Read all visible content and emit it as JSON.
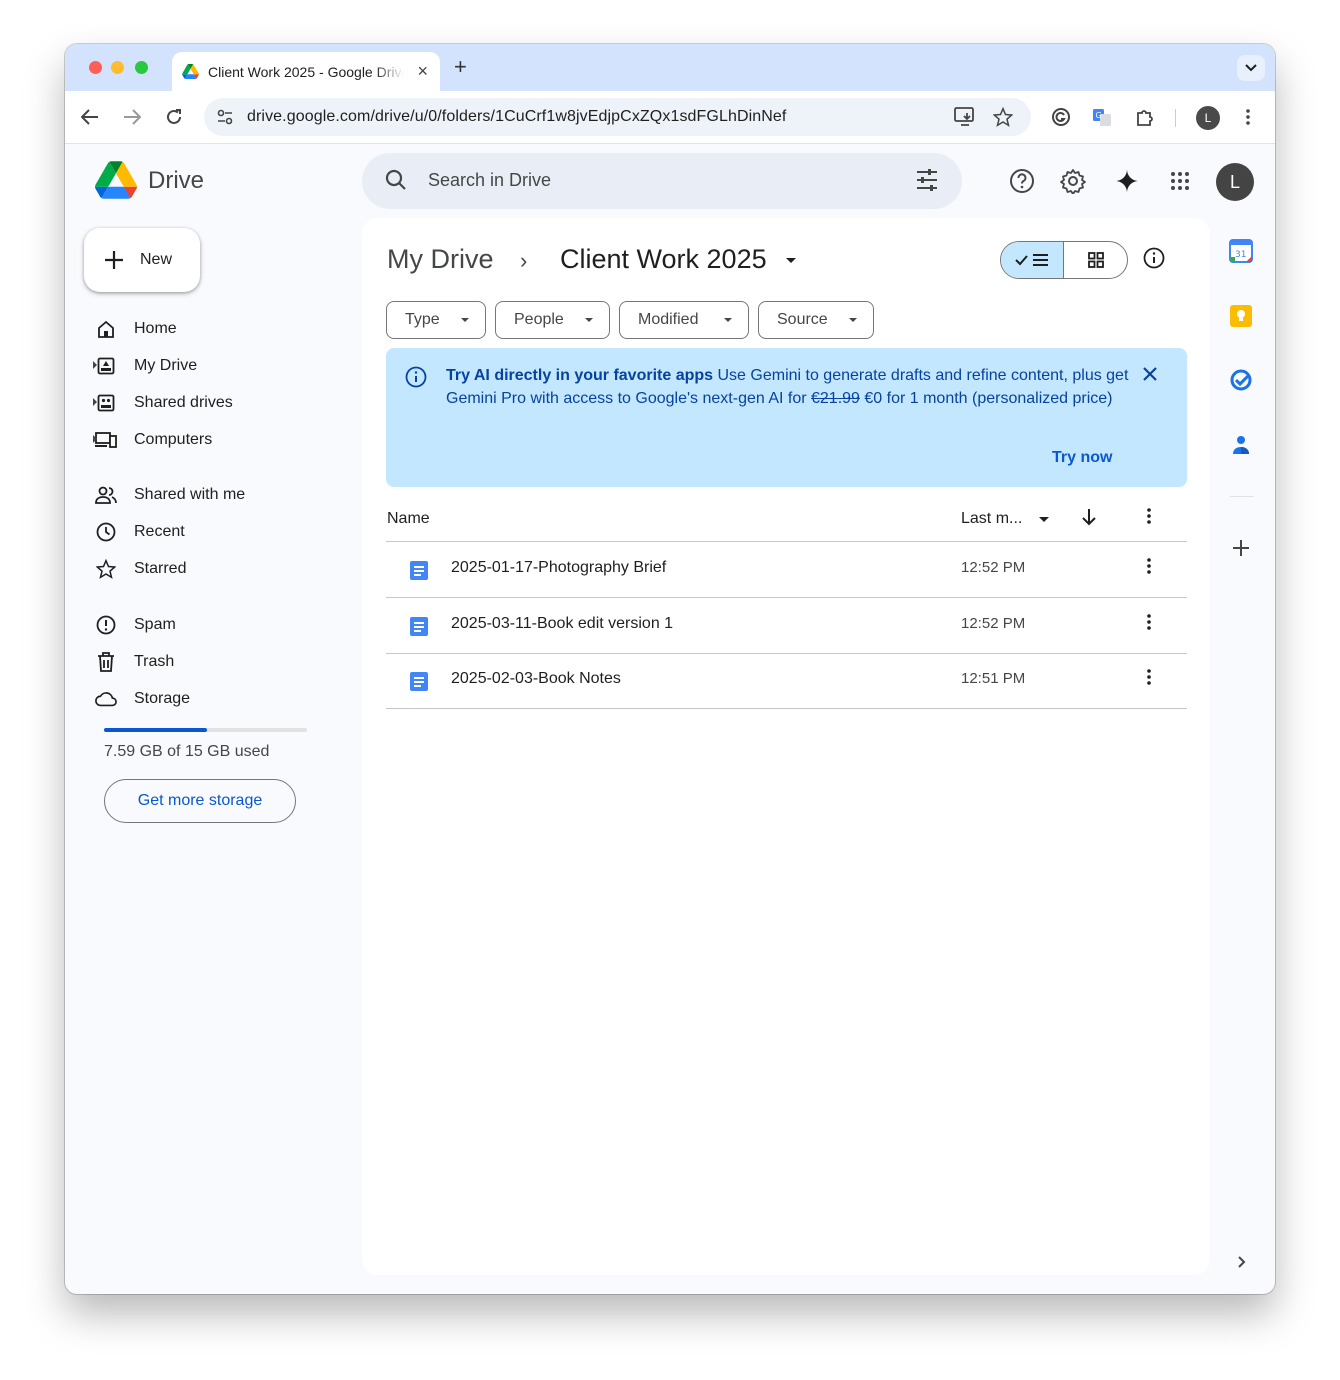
{
  "browser": {
    "tab_title": "Client Work 2025 - Google Drive",
    "url": "drive.google.com/drive/u/0/folders/1CuCrf1w8jvEdjpCxZQx1sdFGLhDinNef",
    "profile_initial": "L"
  },
  "header": {
    "app_name": "Drive",
    "search_placeholder": "Search in Drive",
    "profile_initial": "L"
  },
  "sidebar": {
    "new_label": "New",
    "items": [
      {
        "label": "Home",
        "icon": "home-icon"
      },
      {
        "label": "My Drive",
        "icon": "my-drive-icon"
      },
      {
        "label": "Shared drives",
        "icon": "shared-drives-icon"
      },
      {
        "label": "Computers",
        "icon": "computers-icon"
      },
      {
        "label": "Shared with me",
        "icon": "people-icon"
      },
      {
        "label": "Recent",
        "icon": "clock-icon"
      },
      {
        "label": "Starred",
        "icon": "star-icon"
      },
      {
        "label": "Spam",
        "icon": "spam-icon"
      },
      {
        "label": "Trash",
        "icon": "trash-icon"
      },
      {
        "label": "Storage",
        "icon": "cloud-icon"
      }
    ],
    "storage_used_fraction": 0.506,
    "storage_text": "7.59 GB of 15 GB used",
    "storage_button": "Get more storage"
  },
  "main": {
    "breadcrumb_root": "My Drive",
    "breadcrumb_separator": "›",
    "breadcrumb_current": "Client Work 2025",
    "filters": [
      "Type",
      "People",
      "Modified",
      "Source"
    ],
    "banner": {
      "title": "Try AI directly in your favorite apps",
      "body_1": " Use Gemini to generate drafts and refine content, plus get Gemini Pro with access to Google's next-gen AI for ",
      "old_price": "€21.99",
      "body_2": " €0 for 1 month (personalized price)",
      "action": "Try now"
    },
    "columns": {
      "name": "Name",
      "modified": "Last m..."
    },
    "files": [
      {
        "name": "2025-01-17-Photography Brief",
        "modified": "12:52 PM"
      },
      {
        "name": "2025-03-11-Book edit version 1",
        "modified": "12:52 PM"
      },
      {
        "name": "2025-02-03-Book Notes",
        "modified": "12:51 PM"
      }
    ]
  },
  "colors": {
    "tabstrip": "#d3e3fd",
    "accent": "#0b57d0",
    "banner_bg": "#c2e7ff",
    "doc_blue": "#4285f4"
  }
}
